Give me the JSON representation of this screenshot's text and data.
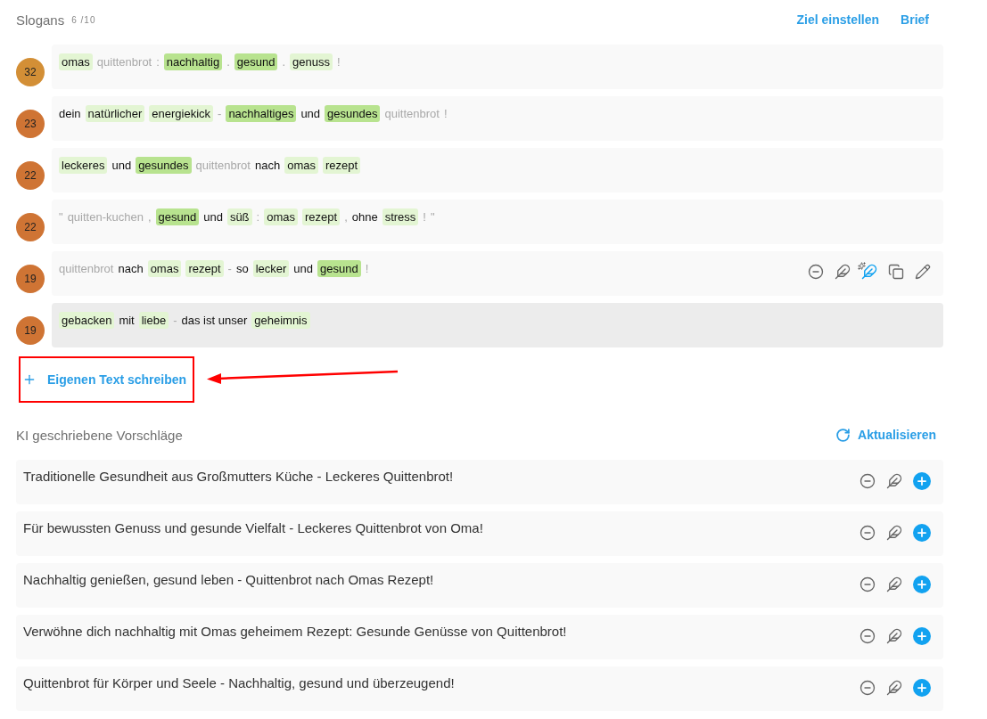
{
  "slogans_header": {
    "title": "Slogans",
    "count": "6 /10",
    "links": [
      "Ziel einstellen",
      "Brief"
    ]
  },
  "slogans": [
    {
      "score": "32",
      "color": "#d38f36",
      "actions_visible": false,
      "highlighted": false,
      "tokens": [
        {
          "text": "omas",
          "kind": "light"
        },
        {
          "text": "quittenbrot",
          "kind": "muted"
        },
        {
          "text": ":",
          "kind": "muted"
        },
        {
          "text": "nachhaltig",
          "kind": "strong"
        },
        {
          "text": ".",
          "kind": "muted"
        },
        {
          "text": "gesund",
          "kind": "strong"
        },
        {
          "text": ".",
          "kind": "muted"
        },
        {
          "text": "genuss",
          "kind": "light"
        },
        {
          "text": "!",
          "kind": "muted"
        }
      ]
    },
    {
      "score": "23",
      "color": "#cf7434",
      "actions_visible": false,
      "highlighted": false,
      "tokens": [
        {
          "text": "dein",
          "kind": "plain"
        },
        {
          "text": "natürlicher",
          "kind": "light"
        },
        {
          "text": "energiekick",
          "kind": "light"
        },
        {
          "text": "-",
          "kind": "muted"
        },
        {
          "text": "nachhaltiges",
          "kind": "strong"
        },
        {
          "text": "und",
          "kind": "plain"
        },
        {
          "text": "gesundes",
          "kind": "strong"
        },
        {
          "text": "quittenbrot",
          "kind": "muted"
        },
        {
          "text": "!",
          "kind": "muted"
        }
      ]
    },
    {
      "score": "22",
      "color": "#cf7434",
      "actions_visible": false,
      "highlighted": false,
      "tokens": [
        {
          "text": "leckeres",
          "kind": "light"
        },
        {
          "text": "und",
          "kind": "plain"
        },
        {
          "text": "gesundes",
          "kind": "strong"
        },
        {
          "text": "quittenbrot",
          "kind": "muted"
        },
        {
          "text": "nach",
          "kind": "plain"
        },
        {
          "text": "omas",
          "kind": "light"
        },
        {
          "text": "rezept",
          "kind": "light"
        }
      ]
    },
    {
      "score": "22",
      "color": "#cf7434",
      "actions_visible": false,
      "highlighted": false,
      "tokens": [
        {
          "text": "\"",
          "kind": "muted"
        },
        {
          "text": "quitten-kuchen",
          "kind": "muted"
        },
        {
          "text": ",",
          "kind": "muted"
        },
        {
          "text": "gesund",
          "kind": "strong"
        },
        {
          "text": "und",
          "kind": "plain"
        },
        {
          "text": "süß",
          "kind": "light"
        },
        {
          "text": ":",
          "kind": "muted"
        },
        {
          "text": "omas",
          "kind": "light"
        },
        {
          "text": "rezept",
          "kind": "light"
        },
        {
          "text": ",",
          "kind": "muted"
        },
        {
          "text": "ohne",
          "kind": "plain"
        },
        {
          "text": "stress",
          "kind": "light"
        },
        {
          "text": "!",
          "kind": "muted"
        },
        {
          "text": "\"",
          "kind": "muted"
        }
      ]
    },
    {
      "score": "19",
      "color": "#cf7434",
      "actions_visible": true,
      "highlighted": false,
      "tokens": [
        {
          "text": "quittenbrot",
          "kind": "muted"
        },
        {
          "text": "nach",
          "kind": "plain"
        },
        {
          "text": "omas",
          "kind": "light"
        },
        {
          "text": "rezept",
          "kind": "light"
        },
        {
          "text": "-",
          "kind": "muted"
        },
        {
          "text": "so",
          "kind": "plain"
        },
        {
          "text": "lecker",
          "kind": "light"
        },
        {
          "text": "und",
          "kind": "plain"
        },
        {
          "text": "gesund",
          "kind": "strong"
        },
        {
          "text": "!",
          "kind": "muted"
        }
      ]
    },
    {
      "score": "19",
      "color": "#cf7434",
      "actions_visible": false,
      "highlighted": true,
      "tokens": [
        {
          "text": "gebacken",
          "kind": "light"
        },
        {
          "text": "mit",
          "kind": "plain"
        },
        {
          "text": "liebe",
          "kind": "light"
        },
        {
          "text": "-",
          "kind": "muted"
        },
        {
          "text": "das ist unser",
          "kind": "plain"
        },
        {
          "text": "geheimnis",
          "kind": "light"
        }
      ]
    }
  ],
  "add_own": {
    "label": "Eigenen Text schreiben",
    "annotated": true
  },
  "suggestions_header": {
    "title": "KI geschriebene Vorschläge",
    "refresh": "Aktualisieren"
  },
  "suggestions": [
    "Traditionelle Gesundheit aus Großmutters Küche - Leckeres Quittenbrot!",
    "Für bewussten Genuss und gesunde Vielfalt - Leckeres Quittenbrot von Oma!",
    "Nachhaltig genießen, gesund leben - Quittenbrot nach Omas Rezept!",
    "Verwöhne dich nachhaltig mit Omas geheimem Rezept: Gesunde Genüsse von Quittenbrot!",
    "Quittenbrot für Körper und Seele - Nachhaltig, gesund und überzeugend!"
  ]
}
